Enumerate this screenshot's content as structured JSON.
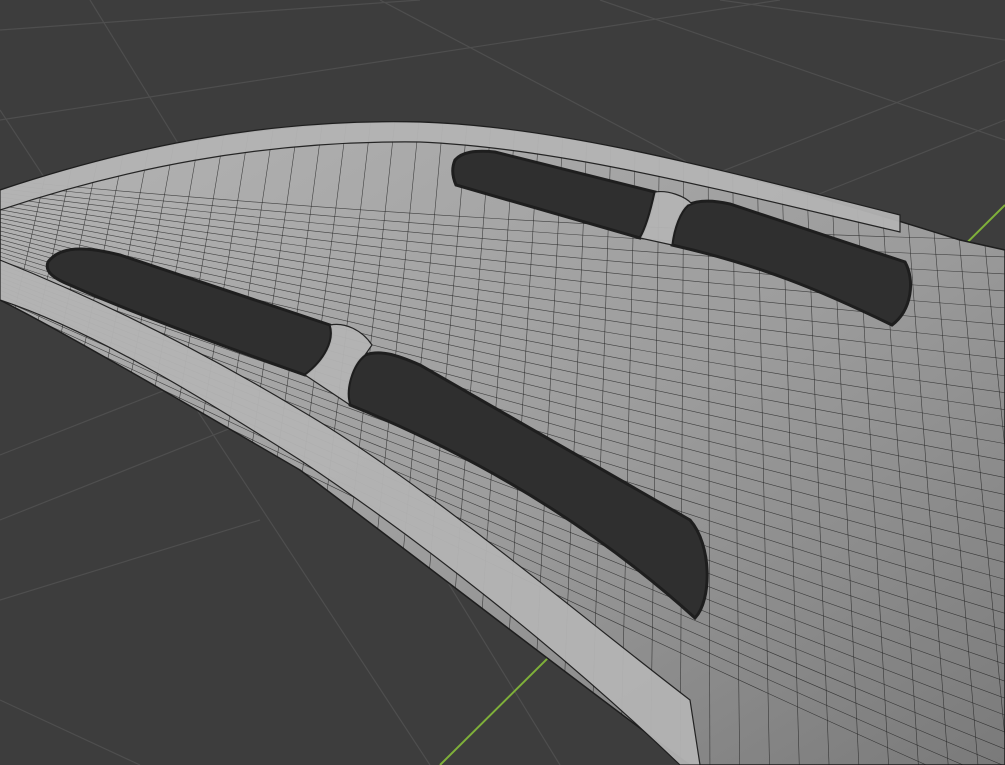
{
  "app": {
    "kind": "3d-modeling-viewport",
    "shading_mode": "solid-with-wireframe-overlay"
  },
  "viewport": {
    "background_color": "#3d3d3d",
    "floor_grid": {
      "visible": true,
      "line_color": "#4e4e4e"
    },
    "y_axis": {
      "visible": true,
      "color": "#7fb03a"
    }
  },
  "mesh": {
    "object": "hood-scoop",
    "surface_color": "#9c9c9c",
    "surface_highlight": "#b4b4b4",
    "surface_shadow": "#7a7a7a",
    "wire_color": "#1e1e1e",
    "opening_color": "#2f2f2f",
    "vent_openings": 4
  }
}
